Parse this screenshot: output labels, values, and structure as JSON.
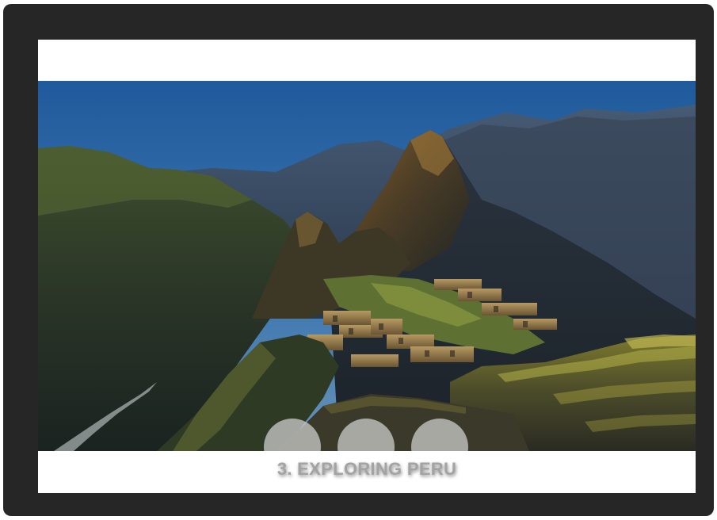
{
  "slide": {
    "caption": "3. EXPLORING PERU",
    "image_subject": "mountain-citadel-photo"
  },
  "navigation": {
    "dots": [
      {
        "label": "",
        "state": "inactive"
      },
      {
        "label": "",
        "state": "inactive"
      },
      {
        "label": "",
        "state": "inactive"
      }
    ]
  },
  "colors": {
    "frame": "#262626",
    "card": "#ffffff",
    "caption_text": "#a3a3a3",
    "dot_fill": "#d2d2d2"
  }
}
